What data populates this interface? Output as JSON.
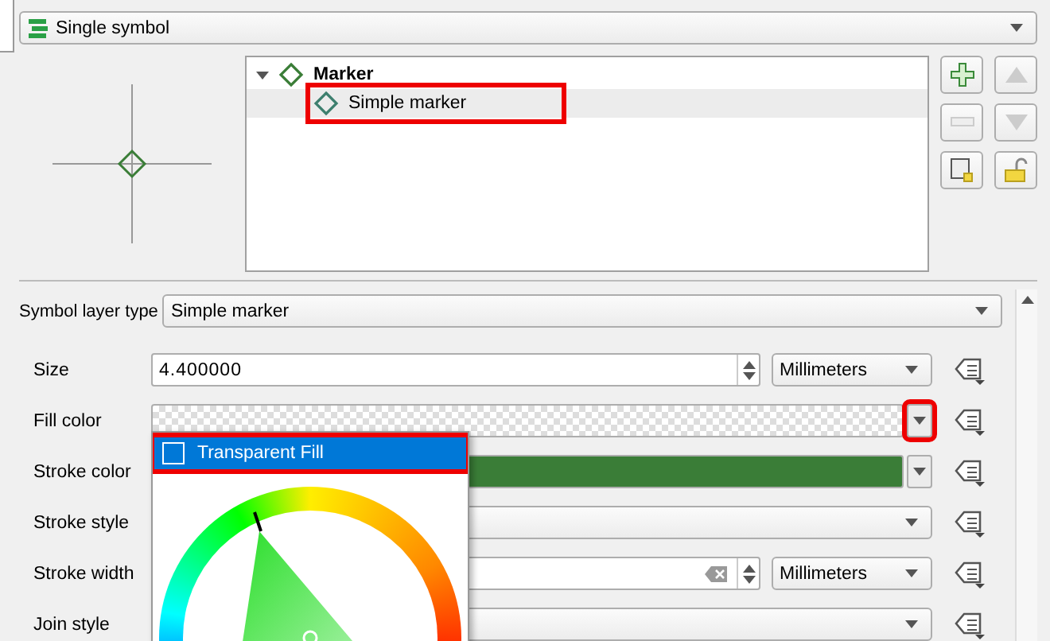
{
  "renderer": {
    "value": "Single symbol"
  },
  "symbol_tree": [
    {
      "label": "Marker",
      "expanded": true,
      "selected": false,
      "highlighted": false,
      "children": [
        {
          "label": "Simple marker",
          "selected": true,
          "highlighted": true
        }
      ]
    }
  ],
  "layer_buttons": [
    {
      "kind": "add",
      "disabled": false
    },
    {
      "kind": "up",
      "disabled": true
    },
    {
      "kind": "remove",
      "disabled": true
    },
    {
      "kind": "down",
      "disabled": true
    },
    {
      "kind": "duplicate",
      "disabled": false
    },
    {
      "kind": "lock",
      "disabled": false
    }
  ],
  "symbol_layer_type": {
    "label": "Symbol layer type",
    "value": "Simple marker"
  },
  "properties": [
    {
      "kind": "number",
      "label": "Size",
      "value": "4.400000",
      "unit": "Millimeters"
    },
    {
      "kind": "transparent-color",
      "label": "Fill color",
      "highlighted": true
    },
    {
      "kind": "color",
      "label": "Stroke color",
      "color": "#3a7d37",
      "highlighted": false
    },
    {
      "kind": "combo",
      "label": "Stroke style"
    },
    {
      "kind": "clearable-number",
      "label": "Stroke width",
      "unit": "Millimeters"
    },
    {
      "kind": "combo",
      "label": "Join style"
    }
  ],
  "color_menu": {
    "items": [
      {
        "label": "Transparent Fill",
        "selected": true,
        "highlighted": true
      }
    ]
  }
}
